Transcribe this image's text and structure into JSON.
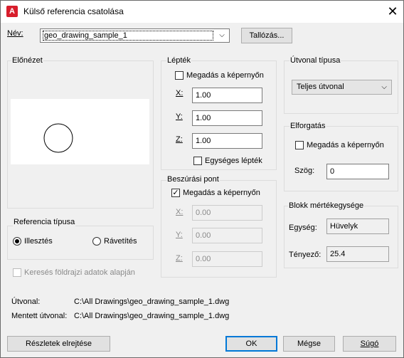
{
  "window": {
    "title": "Külső referencia csatolása",
    "app_icon_letter": "A"
  },
  "name": {
    "label": "Név:",
    "value": "geo_drawing_sample_1",
    "browse_label": "Tallózás..."
  },
  "preview": {
    "label": "Előnézet"
  },
  "scale": {
    "label": "Lépték",
    "specify_on_screen": "Megadás a képernyőn",
    "x_label": "X:",
    "x_value": "1.00",
    "y_label": "Y:",
    "y_value": "1.00",
    "z_label": "Z:",
    "z_value": "1.00",
    "uniform_scale": "Egységes lépték"
  },
  "path_type": {
    "label": "Útvonal típusa",
    "value": "Teljes útvonal"
  },
  "rotation": {
    "label": "Elforgatás",
    "specify_on_screen": "Megadás a képernyőn",
    "angle_label": "Szög:",
    "angle_value": "0"
  },
  "insertion": {
    "label": "Beszúrási pont",
    "specify_on_screen": "Megadás a képernyőn",
    "x_label": "X:",
    "x_value": "0.00",
    "y_label": "Y:",
    "y_value": "0.00",
    "z_label": "Z:",
    "z_value": "0.00"
  },
  "reference_type": {
    "label": "Referencia típusa",
    "attach": "Illesztés",
    "overlay": "Rávetítés"
  },
  "geo_checkbox": "Keresés földrajzi adatok alapján",
  "block_unit": {
    "label": "Blokk mértékegysége",
    "unit_label": "Egység:",
    "unit_value": "Hüvelyk",
    "factor_label": "Tényező:",
    "factor_value": "25.4"
  },
  "paths": {
    "path_label": "Útvonal:",
    "path_value": "C:\\All Drawings\\geo_drawing_sample_1.dwg",
    "saved_label": "Mentett útvonal:",
    "saved_value": "C:\\All Drawings\\geo_drawing_sample_1.dwg"
  },
  "buttons": {
    "details": "Részletek elrejtése",
    "ok": "OK",
    "cancel": "Mégse",
    "help": "Súgó"
  },
  "colors": {
    "accent": "#0078d7",
    "app_icon": "#d81e2c"
  }
}
